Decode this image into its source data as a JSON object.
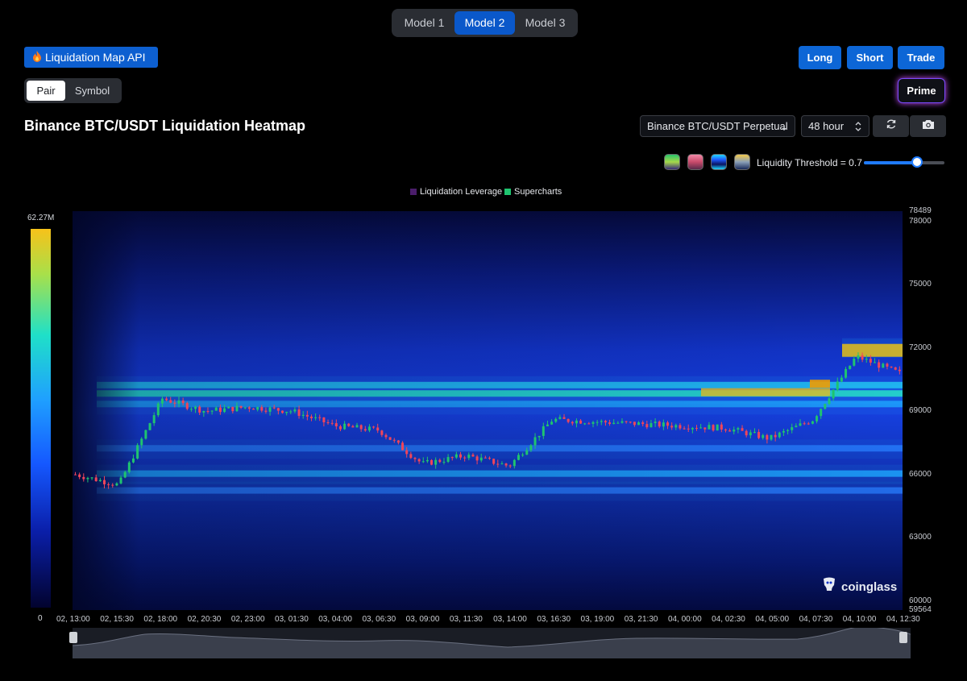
{
  "model_tabs": [
    {
      "label": "Model 1",
      "active": false
    },
    {
      "label": "Model 2",
      "active": true
    },
    {
      "label": "Model 3",
      "active": false
    }
  ],
  "api_button": {
    "label": "Liquidation Map API",
    "icon": "fire-icon"
  },
  "actions": {
    "long": "Long",
    "short": "Short",
    "trade": "Trade"
  },
  "view_toggle": {
    "pair": "Pair",
    "symbol": "Symbol",
    "active": "Pair"
  },
  "prime_label": "Prime",
  "page_title": "Binance BTC/USDT Liquidation Heatmap",
  "controls": {
    "pair_select": "Binance BTC/USDT Perpetual",
    "range_select": "48 hour",
    "refresh_icon": "refresh-icon",
    "camera_icon": "camera-icon"
  },
  "palette_swatches": [
    "#29c46a",
    "#e06a8a",
    "#1f5bff",
    "#f2c94c"
  ],
  "threshold": {
    "label": "Liquidity Threshold = 0.7",
    "value": 0.7
  },
  "legend": [
    {
      "name": "Liquidation Leverage",
      "color": "#4b1d6b"
    },
    {
      "name": "Supercharts",
      "color": "#1fc46f"
    }
  ],
  "colorbar": {
    "max_label": "62.27M",
    "min_label": "0"
  },
  "y_axis": {
    "top": "78489",
    "bottom": "59564",
    "ticks": [
      "78000",
      "75000",
      "72000",
      "69000",
      "66000",
      "63000",
      "60000"
    ]
  },
  "x_axis": {
    "ticks": [
      "02, 13:00",
      "02, 15:30",
      "02, 18:00",
      "02, 20:30",
      "02, 23:00",
      "03, 01:30",
      "03, 04:00",
      "03, 06:30",
      "03, 09:00",
      "03, 11:30",
      "03, 14:00",
      "03, 16:30",
      "03, 19:00",
      "03, 21:30",
      "04, 00:00",
      "04, 02:30",
      "04, 05:00",
      "04, 07:30",
      "04, 10:00",
      "04, 12:30"
    ]
  },
  "watermark": "coinglass",
  "chart_data": {
    "type": "heatmap",
    "title": "Binance BTC/USDT Liquidation Heatmap",
    "ylim": [
      59564,
      78489
    ],
    "colorbar_range": [
      0,
      "62.27M"
    ],
    "price_path_x": [
      "02, 13:00",
      "02, 15:30",
      "02, 18:00",
      "02, 20:30",
      "02, 23:00",
      "03, 01:30",
      "03, 04:00",
      "03, 06:30",
      "03, 09:00",
      "03, 11:30",
      "03, 14:00",
      "03, 16:30",
      "03, 19:00",
      "03, 21:30",
      "04, 00:00",
      "04, 02:30",
      "04, 05:00",
      "04, 07:30",
      "04, 10:00",
      "04, 12:30"
    ],
    "price_path_y": [
      66000,
      65500,
      69600,
      69000,
      69200,
      69000,
      68300,
      68100,
      66500,
      66900,
      66400,
      68600,
      68500,
      68400,
      68300,
      68200,
      67700,
      68600,
      71600,
      70800
    ],
    "liquidity_bands": [
      {
        "price": 72000,
        "intensity": 0.95
      },
      {
        "price": 70200,
        "intensity": 0.75
      },
      {
        "price": 69800,
        "intensity": 0.85
      },
      {
        "price": 69300,
        "intensity": 0.6
      },
      {
        "price": 67200,
        "intensity": 0.5
      },
      {
        "price": 66000,
        "intensity": 0.6
      },
      {
        "price": 65200,
        "intensity": 0.45
      }
    ]
  }
}
